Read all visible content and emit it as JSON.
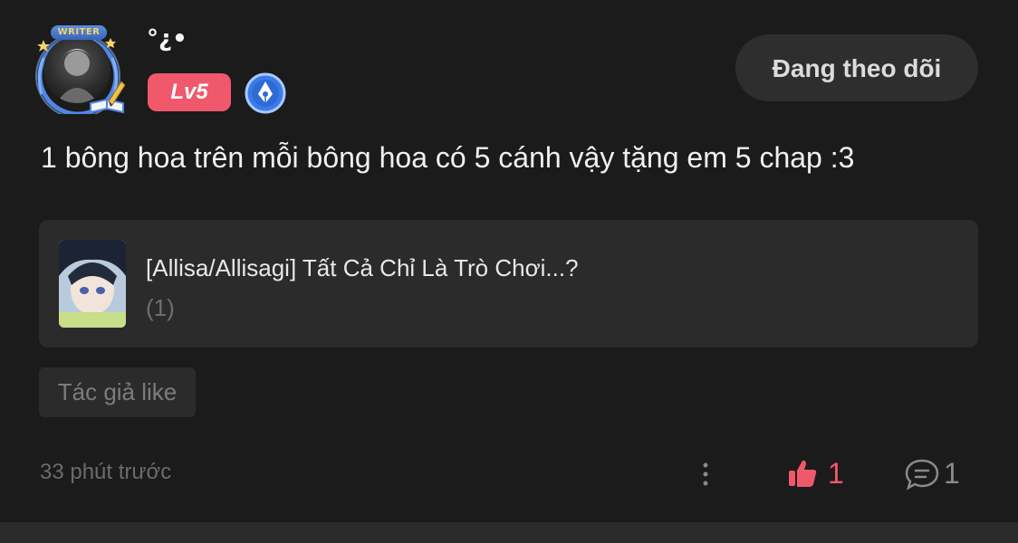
{
  "user": {
    "avatar_frame_label": "WRITER",
    "name": "°¿•",
    "level": "Lv5"
  },
  "follow_button": {
    "label": "Đang theo dõi"
  },
  "comment": {
    "text": "1 bông hoa trên mỗi bông hoa có 5 cánh vậy tặng em 5 chap :3"
  },
  "story": {
    "title": "[Allisa/Allisagi] Tất Cả Chỉ Là Trò Chơi...?",
    "count": "(1)"
  },
  "author_like": {
    "label": "Tác giả like"
  },
  "footer": {
    "timestamp": "33 phút trước",
    "likes": "1",
    "comments": "1"
  },
  "icons": {
    "more": "more-vertical-icon",
    "like": "thumbs-up-icon",
    "comment": "comment-bubble-icon",
    "writer_badge": "pen-nib-badge-icon"
  },
  "colors": {
    "background": "#1b1b1b",
    "accent": "#f0586c",
    "card": "#2b2b2b",
    "badge_blue": "#3b7be8"
  }
}
